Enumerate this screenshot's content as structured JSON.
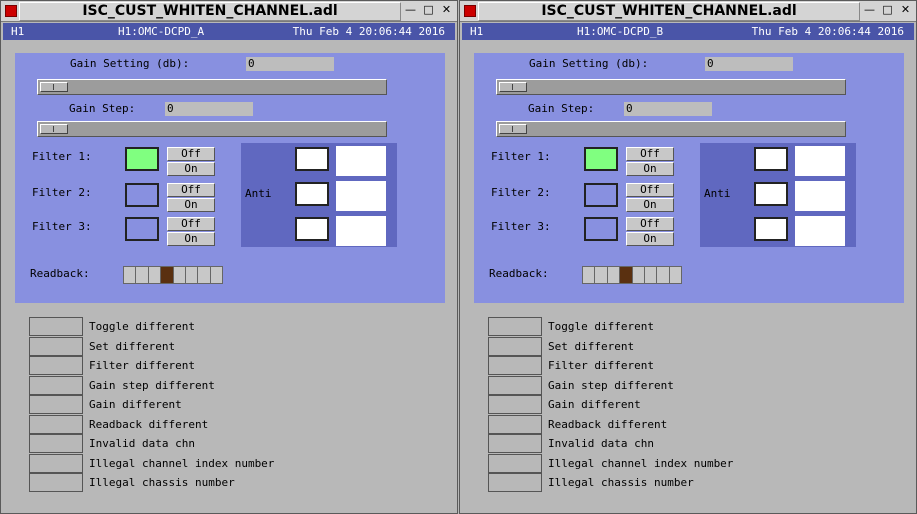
{
  "title": "ISC_CUST_WHITEN_CHANNEL.adl",
  "site": "H1",
  "date": "Thu Feb  4 20:06:44 2016",
  "labels": {
    "gain_setting": "Gain Setting (db):",
    "gain_step": "Gain Step:",
    "filter1": "Filter 1:",
    "filter2": "Filter 2:",
    "filter3": "Filter 3:",
    "anti": "Anti",
    "readback": "Readback:",
    "off": "Off",
    "on": "On"
  },
  "status_labels": [
    "Toggle different",
    "Set different",
    "Filter different",
    "Gain step different",
    "Gain different",
    "Readback different",
    "Invalid data chn",
    "Illegal channel index number",
    "Illegal chassis number"
  ],
  "windows": [
    {
      "channel": "H1:OMC-DCPD_A",
      "gain_setting": "0",
      "gain_step": "0",
      "filter_states": [
        true,
        false,
        false
      ],
      "readback_set_index": 3
    },
    {
      "channel": "H1:OMC-DCPD_B",
      "gain_setting": "0",
      "gain_step": "0",
      "filter_states": [
        true,
        false,
        false
      ],
      "readback_set_index": 3
    }
  ],
  "colors": {
    "panel": "#8890e0",
    "infobar": "#4a55a8",
    "led_on": "#80ff80",
    "readback_set": "#5a3010"
  }
}
